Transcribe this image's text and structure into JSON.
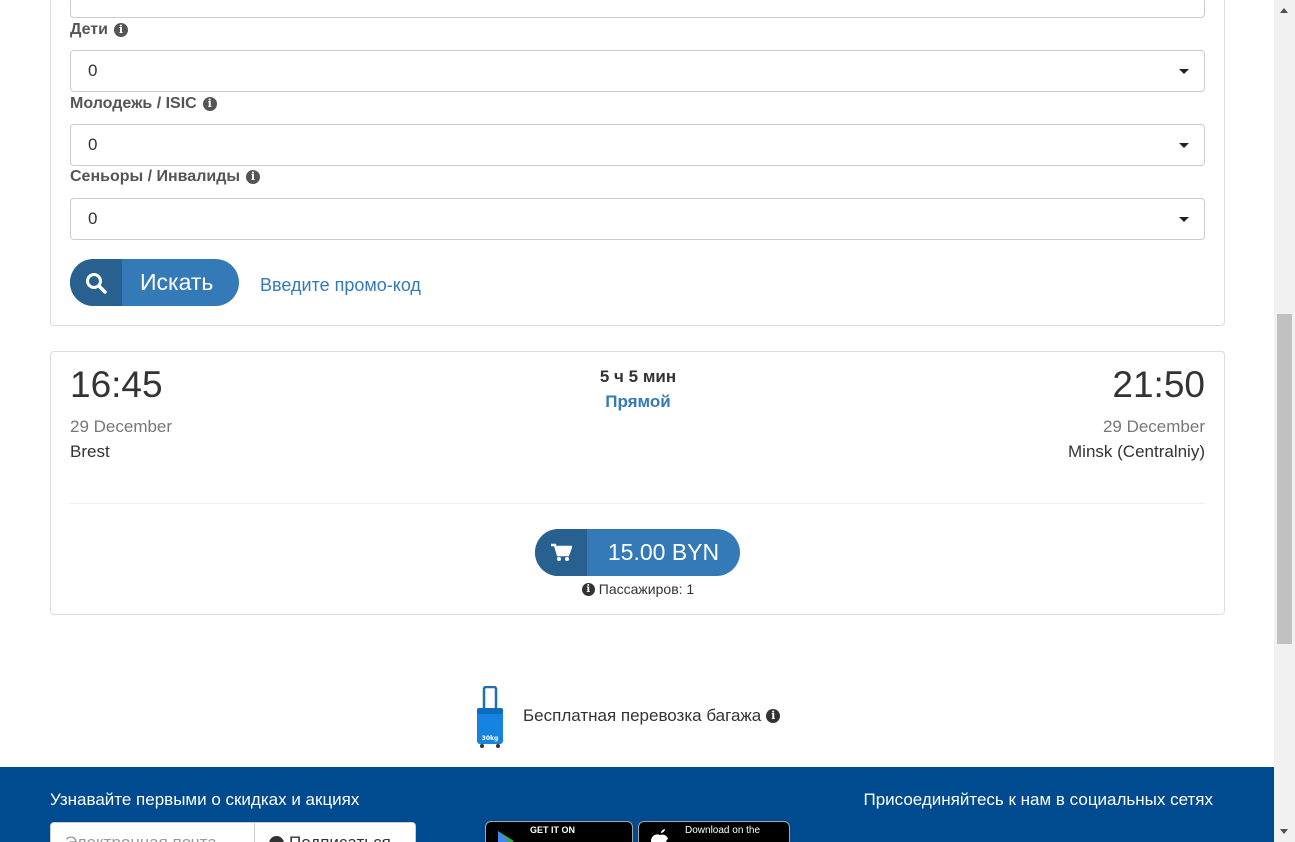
{
  "form": {
    "children_label": "Дети",
    "children_value": "0",
    "youth_label": "Молодежь / ISIC",
    "youth_value": "0",
    "seniors_label": "Сеньоры / Инвалиды",
    "seniors_value": "0",
    "search_button": "Искать",
    "promo_link": "Введите промо-код"
  },
  "trip": {
    "departure_time": "16:45",
    "departure_date": "29 December",
    "departure_station": "Brest",
    "duration": "5 ч 5 мин",
    "route_type": "Прямой",
    "arrival_time": "21:50",
    "arrival_date": "29 December",
    "arrival_station": "Minsk (Centralniy)",
    "price": "15.00 BYN",
    "passengers": "Пассажиров: 1"
  },
  "baggage": {
    "text": "Бесплатная перевозка багажа",
    "bag_weight": "30kg"
  },
  "footer": {
    "newsletter_title": "Узнавайте первыми о скидках и акциях",
    "email_placeholder": "Электронная почта",
    "subscribe_button": "Подписаться",
    "google_play_small": "GET IT ON",
    "app_store_small": "Download on the",
    "social_title": "Присоединяйтесь к нам в социальных сетях"
  },
  "colors": {
    "primary": "#337ab7",
    "primary_dark": "#286090",
    "footer_bg": "#004a8f"
  }
}
